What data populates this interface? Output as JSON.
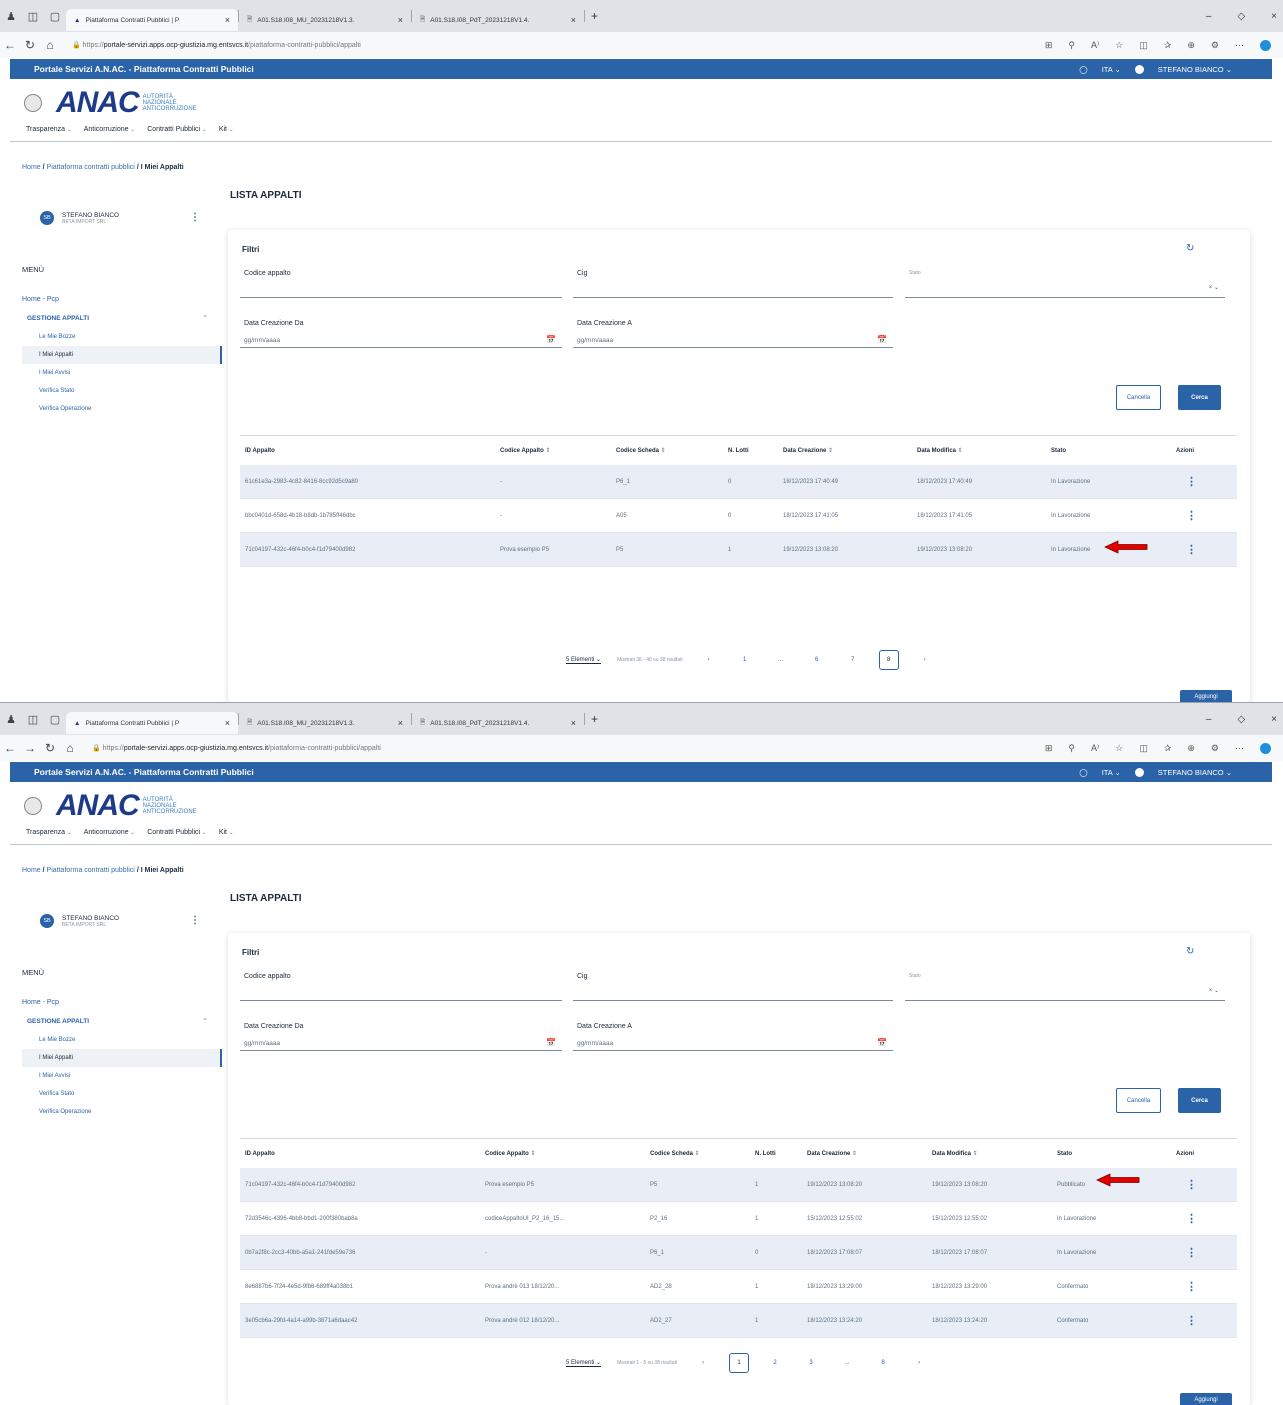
{
  "browser": {
    "tabs": [
      "Piattaforma Contratti Pubblici | P",
      "A01.S18.I08_MU_20231218V1.3.",
      "A01.S18.I08_PdT_20231218V1.4."
    ],
    "url_prefix": "https://",
    "url_host": "portale-servizi.apps.ocp-giustizia.mg.entsvcs.it",
    "url_path": "/piattaforma-contratti-pubblici/appalti"
  },
  "site": {
    "portal_title": "Portale Servizi A.N.AC. - Piattaforma Contratti Pubblici",
    "lang": "ITA",
    "user_top": "STEFANO BIANCO",
    "logo_word": "ANAC",
    "logo_sub": [
      "AUTORITÀ",
      "NAZIONALE",
      "ANTICORRUZIONE"
    ],
    "nav": [
      "Trasparenza",
      "Anticorruzione",
      "Contratti Pubblici",
      "Kit"
    ],
    "breadcrumb": [
      "Home",
      "Piattaforma contratti pubblici",
      "I Miei Appalti"
    ],
    "user": {
      "initials": "SB",
      "name": "STEFANO BIANCO",
      "company": "BETA IMPORT SRL"
    },
    "menu_title": "MENÙ",
    "menu": {
      "home": "Home - Pcp",
      "group": "GESTIONE APPALTI",
      "items": [
        "Le Mie Bozze",
        "I Miei Appalti",
        "I Miei Avvisi",
        "Verifica Stato",
        "Verifica Operazione"
      ]
    },
    "page_title": "LISTA APPALTI",
    "filters": {
      "title": "Filtri",
      "codice": "Codice appalto",
      "cig": "Cig",
      "stato": "Stato",
      "da": "Data Creazione Da",
      "a": "Data Creazione A",
      "date_placeholder": "gg/mm/aaaa",
      "clear": "Cancella",
      "search": "Cerca"
    },
    "columns": [
      "ID Appalto",
      "Codice Appalto",
      "Codice Scheda",
      "N. Lotti",
      "Data Creazione",
      "Data Modifica",
      "Stato",
      "Azioni"
    ],
    "add": "Aggiungi"
  },
  "screen1": {
    "rows": [
      {
        "id": "61c61e3a-2983-4c82-8416-8cc92d5c9a80",
        "codice": "-",
        "scheda": "P6_1",
        "lotti": "0",
        "creazione": "18/12/2023 17:40:49",
        "modifica": "18/12/2023 17:40:49",
        "stato": "In Lavorazione"
      },
      {
        "id": "bbc0401d-658d-4b18-b8db-1b785ff46dbc",
        "codice": "-",
        "scheda": "A05",
        "lotti": "0",
        "creazione": "18/12/2023 17:41:05",
        "modifica": "18/12/2023 17:41:05",
        "stato": "In Lavorazione"
      },
      {
        "id": "71c04197-432c-46f4-b0c4-f1d79400d982",
        "codice": "Prova esempio P5",
        "scheda": "P5",
        "lotti": "1",
        "creazione": "19/12/2023 13:08:20",
        "modifica": "19/12/2023 13:08:20",
        "stato": "In Lavorazione"
      }
    ],
    "pagination": {
      "elements": "5 Elementi",
      "info": "Mostrati 36 - 40 su 38 risultati",
      "pages": [
        "1",
        "...",
        "6",
        "7",
        "8"
      ],
      "current": "8"
    }
  },
  "screen2": {
    "rows": [
      {
        "id": "71c04197-432c-46f4-b0c4-f1d79400d982",
        "codice": "Prova esempio P5",
        "scheda": "P5",
        "lotti": "1",
        "creazione": "19/12/2023 13:08:20",
        "modifica": "19/12/2023 13:08:20",
        "stato": "Pubblicato"
      },
      {
        "id": "72d3546c-4396-4bb8-bbd1-200f380bab8a",
        "codice": "codiceAppaltoUI_P2_16_15...",
        "scheda": "P2_16",
        "lotti": "1",
        "creazione": "15/12/2023 12:55:02",
        "modifica": "15/12/2023 12:55:02",
        "stato": "In Lavorazione"
      },
      {
        "id": "0b7a2f8c-2cc3-40bb-a5a1-241fde59e736",
        "codice": "-",
        "scheda": "P6_1",
        "lotti": "0",
        "creazione": "18/12/2023 17:08:07",
        "modifica": "18/12/2023 17:08:07",
        "stato": "In Lavorazione"
      },
      {
        "id": "8e6887b6-7f24-4e5d-9fb6-689ff4a038b1",
        "codice": "Prova andrè 013 18/12/20...",
        "scheda": "AD2_28",
        "lotti": "1",
        "creazione": "18/12/2023 13:29:00",
        "modifica": "18/12/2023 13:29:00",
        "stato": "Confermato"
      },
      {
        "id": "3e05cb6a-29fd-4a14-a99b-3871a6daac42",
        "codice": "Prova andrè 012 18/12/20...",
        "scheda": "AD2_27",
        "lotti": "1",
        "creazione": "18/12/2023 13:24:20",
        "modifica": "18/12/2023 13:24:20",
        "stato": "Confermato"
      }
    ],
    "pagination": {
      "elements": "5 Elementi",
      "info": "Mostrati 1 - 5 su 38 risultati",
      "pages": [
        "1",
        "2",
        "3",
        "...",
        "8"
      ],
      "current": "1"
    }
  },
  "colors": {
    "primary": "#2a63a8",
    "alt_row": "#e9eef6",
    "arrow": "#e00000"
  }
}
